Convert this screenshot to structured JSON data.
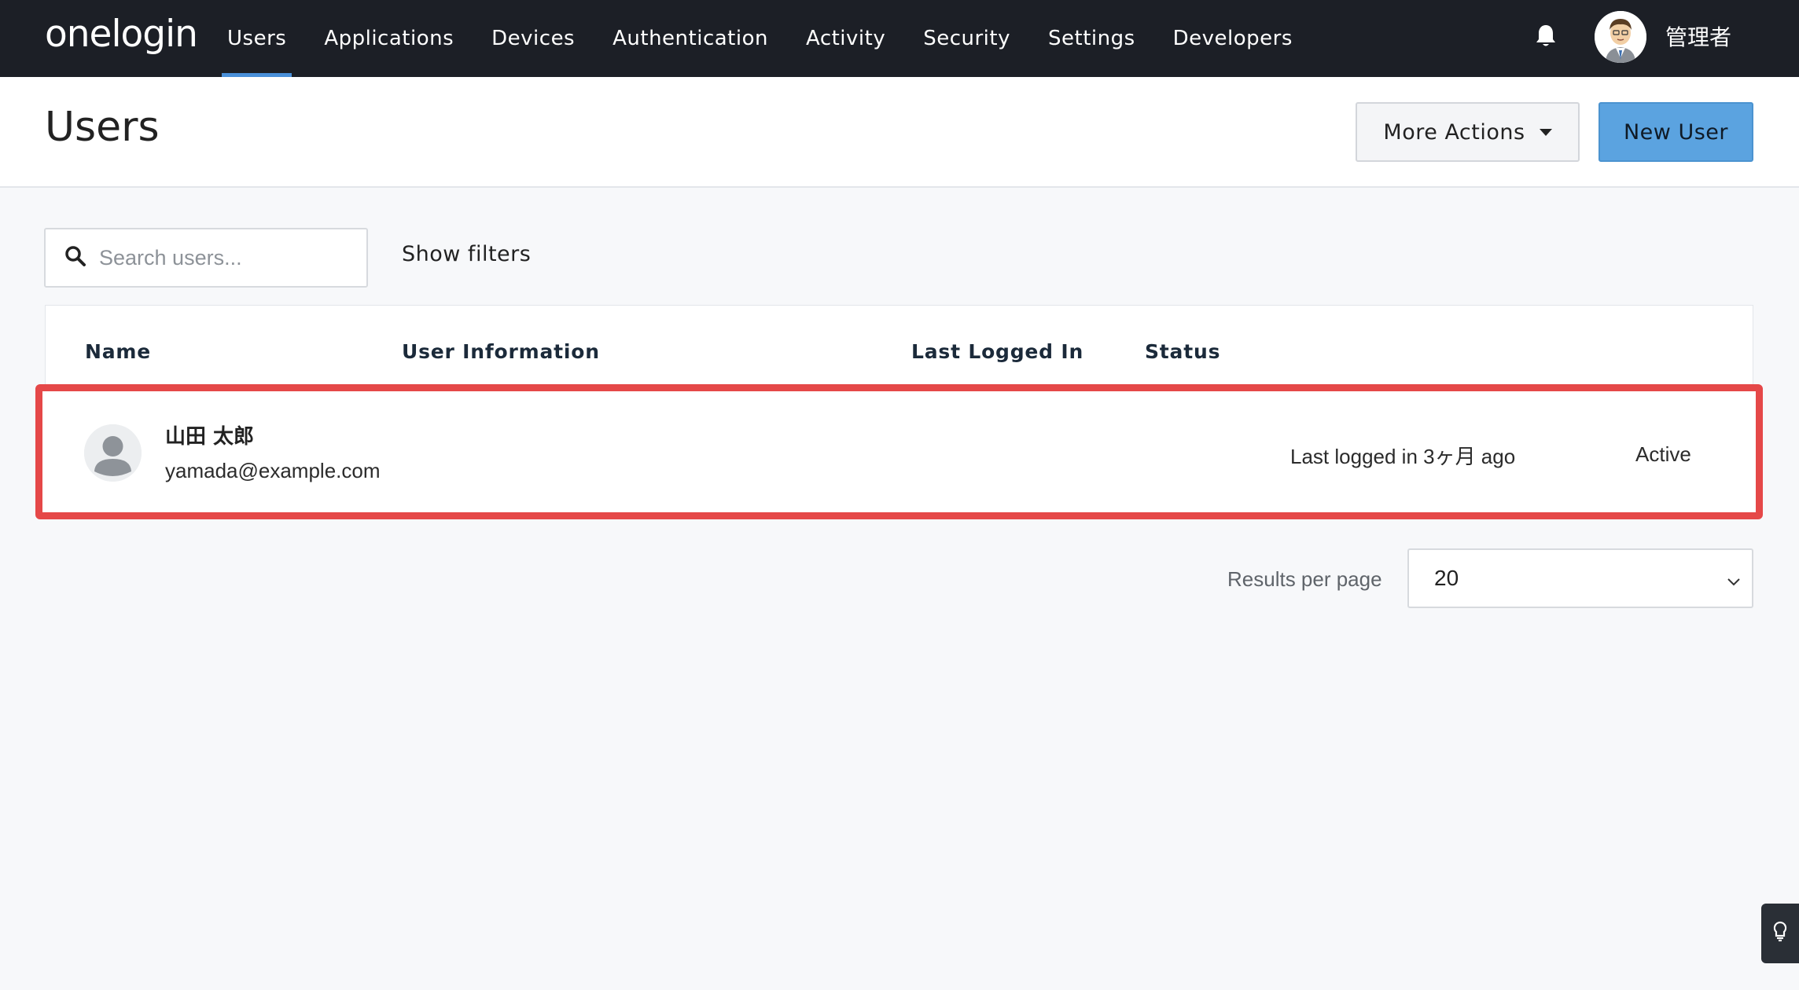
{
  "app": {
    "logo_text": "onelogin"
  },
  "nav": {
    "items": [
      {
        "label": "Users",
        "active": true
      },
      {
        "label": "Applications",
        "active": false
      },
      {
        "label": "Devices",
        "active": false
      },
      {
        "label": "Authentication",
        "active": false
      },
      {
        "label": "Activity",
        "active": false
      },
      {
        "label": "Security",
        "active": false
      },
      {
        "label": "Settings",
        "active": false
      },
      {
        "label": "Developers",
        "active": false
      }
    ],
    "notification_icon": "bell-icon",
    "user_name": "管理者"
  },
  "header": {
    "title": "Users",
    "more_actions_label": "More Actions",
    "new_user_label": "New User"
  },
  "search": {
    "placeholder": "Search users...",
    "value": "",
    "show_filters_label": "Show filters"
  },
  "table": {
    "columns": [
      "Name",
      "User Information",
      "Last Logged In",
      "Status"
    ],
    "rows": [
      {
        "name": "山田 太郎",
        "email": "yamada@example.com",
        "last_logged_in": "Last logged in 3ヶ月 ago",
        "status": "Active"
      }
    ]
  },
  "pagination": {
    "results_per_page_label": "Results per page",
    "results_per_page_value": "20"
  },
  "colors": {
    "nav_bg": "#1c1f26",
    "accent": "#4a90d9",
    "primary_button": "#5ba3e0",
    "highlight": "#e54848"
  }
}
